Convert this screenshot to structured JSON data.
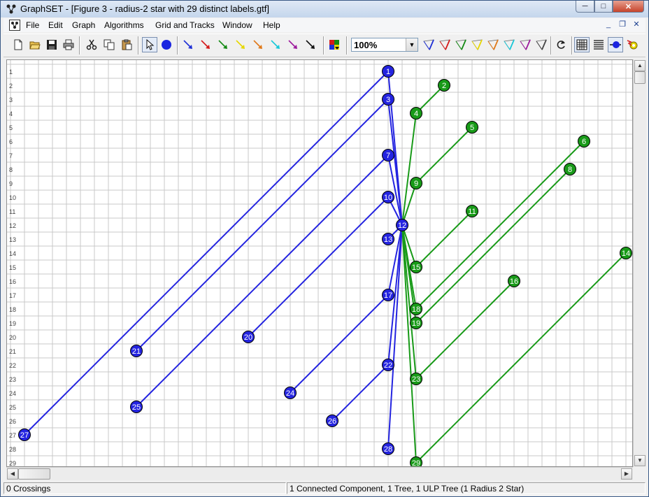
{
  "window": {
    "title": "GraphSET - [Figure 3 - radius-2 star with 29 distinct labels.gtf]",
    "minimize_glyph": "─",
    "maximize_glyph": "□",
    "close_glyph": "✕"
  },
  "menu": {
    "items": [
      "File",
      "Edit",
      "Graph",
      "Algorithms",
      "Grid and Tracks",
      "Window",
      "Help"
    ]
  },
  "mdi": {
    "minimize": "_",
    "restore": "❐",
    "close": "✕"
  },
  "toolbar": {
    "zoom_value": "100%",
    "arrow_colors": [
      "#1d2fd6",
      "#d41a1a",
      "#138a13",
      "#e6d700",
      "#e07818",
      "#18c8d8",
      "#9c1a9c",
      "#111111"
    ],
    "triangle_colors": [
      "#1d2fd6",
      "#d41a1a",
      "#138a13",
      "#e6d700",
      "#e07818",
      "#18c8d8",
      "#9c1a9c",
      "#444444"
    ]
  },
  "colors": {
    "blue": "#2424e0",
    "green": "#189a18",
    "grid": "#c8c8c8"
  },
  "graph": {
    "row_labels": [
      "1",
      "2",
      "3",
      "4",
      "5",
      "6",
      "7",
      "8",
      "9",
      "10",
      "11",
      "12",
      "13",
      "14",
      "15",
      "16",
      "17",
      "18",
      "19",
      "20",
      "21",
      "22",
      "23",
      "24",
      "25",
      "26",
      "27",
      "28",
      "29"
    ],
    "nodes": [
      {
        "id": "1",
        "col": 27,
        "row": 1,
        "color": "blue"
      },
      {
        "id": "2",
        "col": 31,
        "row": 2,
        "color": "green"
      },
      {
        "id": "3",
        "col": 27,
        "row": 3,
        "color": "blue"
      },
      {
        "id": "4",
        "col": 29,
        "row": 4,
        "color": "green"
      },
      {
        "id": "5",
        "col": 33,
        "row": 5,
        "color": "green"
      },
      {
        "id": "6",
        "col": 41,
        "row": 6,
        "color": "green"
      },
      {
        "id": "7",
        "col": 27,
        "row": 7,
        "color": "blue"
      },
      {
        "id": "8",
        "col": 40,
        "row": 8,
        "color": "green"
      },
      {
        "id": "9",
        "col": 29,
        "row": 9,
        "color": "green"
      },
      {
        "id": "10",
        "col": 27,
        "row": 10,
        "color": "blue"
      },
      {
        "id": "11",
        "col": 33,
        "row": 11,
        "color": "green"
      },
      {
        "id": "12",
        "col": 28,
        "row": 12,
        "color": "blue"
      },
      {
        "id": "13",
        "col": 27,
        "row": 13,
        "color": "blue"
      },
      {
        "id": "14",
        "col": 44,
        "row": 14,
        "color": "green"
      },
      {
        "id": "15",
        "col": 29,
        "row": 15,
        "color": "green"
      },
      {
        "id": "16",
        "col": 36,
        "row": 16,
        "color": "green"
      },
      {
        "id": "17",
        "col": 27,
        "row": 17,
        "color": "blue"
      },
      {
        "id": "18",
        "col": 29,
        "row": 18,
        "color": "green"
      },
      {
        "id": "19",
        "col": 29,
        "row": 19,
        "color": "green"
      },
      {
        "id": "20",
        "col": 17,
        "row": 20,
        "color": "blue"
      },
      {
        "id": "21",
        "col": 9,
        "row": 21,
        "color": "blue"
      },
      {
        "id": "22",
        "col": 27,
        "row": 22,
        "color": "blue"
      },
      {
        "id": "23",
        "col": 29,
        "row": 23,
        "color": "green"
      },
      {
        "id": "24",
        "col": 20,
        "row": 24,
        "color": "blue"
      },
      {
        "id": "25",
        "col": 9,
        "row": 25,
        "color": "blue"
      },
      {
        "id": "26",
        "col": 23,
        "row": 26,
        "color": "blue"
      },
      {
        "id": "27",
        "col": 1,
        "row": 27,
        "color": "blue"
      },
      {
        "id": "28",
        "col": 27,
        "row": 28,
        "color": "blue"
      },
      {
        "id": "29",
        "col": 29,
        "row": 29,
        "color": "green"
      }
    ],
    "edges": [
      {
        "from": "12",
        "to": "1",
        "color": "blue"
      },
      {
        "from": "12",
        "to": "3",
        "color": "blue"
      },
      {
        "from": "12",
        "to": "7",
        "color": "blue"
      },
      {
        "from": "12",
        "to": "10",
        "color": "blue"
      },
      {
        "from": "12",
        "to": "13",
        "color": "blue"
      },
      {
        "from": "12",
        "to": "17",
        "color": "blue"
      },
      {
        "from": "12",
        "to": "22",
        "color": "blue"
      },
      {
        "from": "12",
        "to": "28",
        "color": "blue"
      },
      {
        "from": "1",
        "to": "27",
        "color": "blue"
      },
      {
        "from": "3",
        "to": "21",
        "color": "blue"
      },
      {
        "from": "7",
        "to": "25",
        "color": "blue"
      },
      {
        "from": "10",
        "to": "20",
        "color": "blue"
      },
      {
        "from": "17",
        "to": "24",
        "color": "blue"
      },
      {
        "from": "22",
        "to": "26",
        "color": "blue"
      },
      {
        "from": "12",
        "to": "4",
        "color": "green"
      },
      {
        "from": "12",
        "to": "9",
        "color": "green"
      },
      {
        "from": "12",
        "to": "15",
        "color": "green"
      },
      {
        "from": "12",
        "to": "18",
        "color": "green"
      },
      {
        "from": "12",
        "to": "19",
        "color": "green"
      },
      {
        "from": "12",
        "to": "23",
        "color": "green"
      },
      {
        "from": "12",
        "to": "29",
        "color": "green"
      },
      {
        "from": "4",
        "to": "2",
        "color": "green"
      },
      {
        "from": "9",
        "to": "5",
        "color": "green"
      },
      {
        "from": "15",
        "to": "11",
        "color": "green"
      },
      {
        "from": "18",
        "to": "6",
        "color": "green"
      },
      {
        "from": "19",
        "to": "8",
        "color": "green"
      },
      {
        "from": "23",
        "to": "16",
        "color": "green"
      },
      {
        "from": "29",
        "to": "14",
        "color": "green"
      }
    ]
  },
  "status": {
    "crossings": "0 Crossings",
    "summary": "1 Connected Component, 1 Tree, 1 ULP Tree (1 Radius 2 Star)"
  }
}
